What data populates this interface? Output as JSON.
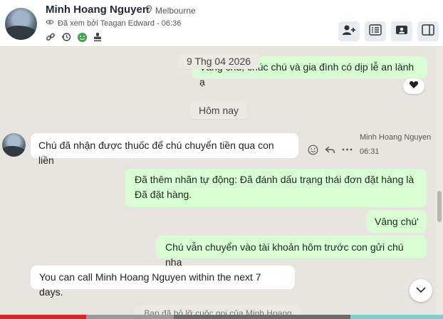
{
  "header": {
    "name": "Minh Hoang Nguyen",
    "location": "Melbourne",
    "seen_text": "Đã xem bởi Teagan Edward - 06:36"
  },
  "chat": {
    "date_separator": "9 Thg 04 2026",
    "partial_message": "Vâng chú, chúc chú và gia đình có dịp lễ an lành ạ",
    "today_separator": "Hôm nay",
    "sender_name": "Minh Hoang Nguyen",
    "sender_time": "06:31",
    "incoming_1": "Chú đã nhận được thuốc để chú chuyển tiền qua con liền",
    "auto_line_1": "Đã thêm nhãn tự động: Đã đánh dấu trạng thái đơn đặt hàng là",
    "auto_line_2": "Đã đặt hàng.",
    "out_1": "Vâng chú'",
    "out_2": "Chú vẫn chuyển vào tài khoản hôm trước con gửi chú nha",
    "call_notice": "You can call Minh Hoang Nguyen within the next 7 days.",
    "bottom_notice": "Bạn đã bỏ lỡ cuộc gọi của Minh Hoang"
  },
  "colors": {
    "outgoing_bubble": "#d9fdd3",
    "incoming_bubble": "#ffffff",
    "chat_background": "#e8e4df",
    "accent": "#3b5998"
  },
  "icons": {
    "location": "map-pin-icon",
    "seen": "eye-icon",
    "link": "link-icon",
    "history": "history-icon",
    "ai_face": "smile-icon",
    "stamp": "stamp-icon",
    "add_person": "add-person-icon",
    "list": "list-icon",
    "contact_card": "contact-card-icon",
    "sidebar": "sidebar-panel-icon",
    "heart": "heart-icon",
    "emoji": "emoji-icon",
    "reply": "reply-icon",
    "more": "more-icon",
    "scroll_down": "chevron-down-icon"
  }
}
